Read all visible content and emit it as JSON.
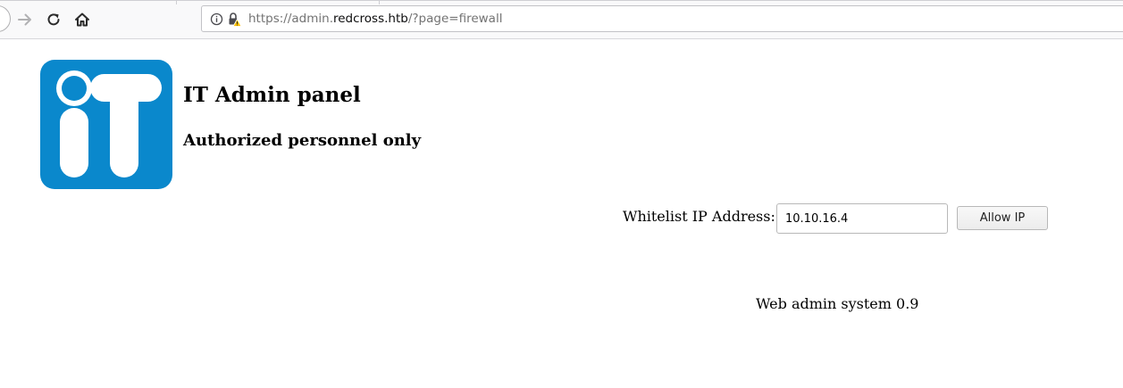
{
  "browser": {
    "url": {
      "scheme": "https://admin.",
      "host": "redcross.htb",
      "path": "/?page=firewall"
    }
  },
  "page": {
    "title": "IT Admin panel",
    "subtitle": "Authorized personnel only",
    "whitelist": {
      "label": "Whitelist IP Address:",
      "value": "10.10.16.4",
      "button_label": "Allow IP"
    },
    "footer": "Web admin system 0.9"
  },
  "colors": {
    "logo_blue": "#0a88cc"
  }
}
